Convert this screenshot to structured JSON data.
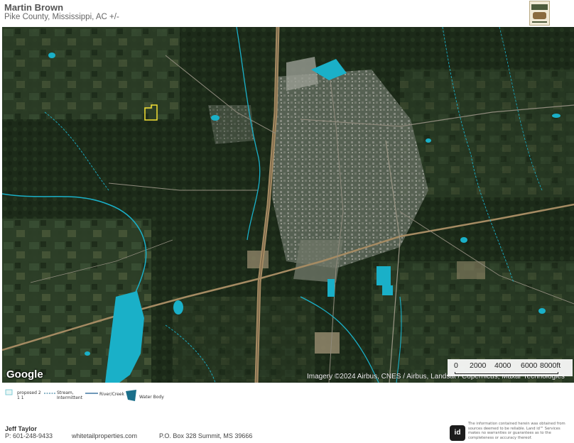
{
  "header": {
    "title": "Martin Brown",
    "subtitle": "Pike County, Mississippi,  AC +/-"
  },
  "map": {
    "google_label": "Google",
    "attribution": "Imagery ©2024 Airbus, CNES / Airbus, Landsat / Copernicus, Maxar Technologies",
    "scale": {
      "labels": [
        "0",
        "2000",
        "4000",
        "6000",
        "8000ft"
      ]
    },
    "colors": {
      "water": "#1ab0c8",
      "parcel_outline": "#f3e034",
      "highway": "#a58b63",
      "imagery_dark": "#1f2d1c",
      "urban": "#8a8f86"
    }
  },
  "legend": {
    "items": [
      {
        "label": "proposed 2 1 1",
        "icon": "parcel-outline-icon"
      },
      {
        "label": "Stream, Intermittent",
        "icon": "dashed-stream-icon"
      },
      {
        "label": "River/Creek",
        "icon": "river-line-icon"
      },
      {
        "label": "Water Body",
        "icon": "water-body-icon"
      }
    ]
  },
  "footer": {
    "agent_name": "Jeff Taylor",
    "agent_phone": "P: 601-248-9433",
    "website": "whitetailproperties.com",
    "address": "P.O. Box 328 Summit, MS 39666",
    "id_logo": "id",
    "disclaimer": "The information contained herein was obtained from sources deemed to be reliable. Land id™ Services makes no warranties or guarantees as to the completeness or accuracy thereof."
  }
}
